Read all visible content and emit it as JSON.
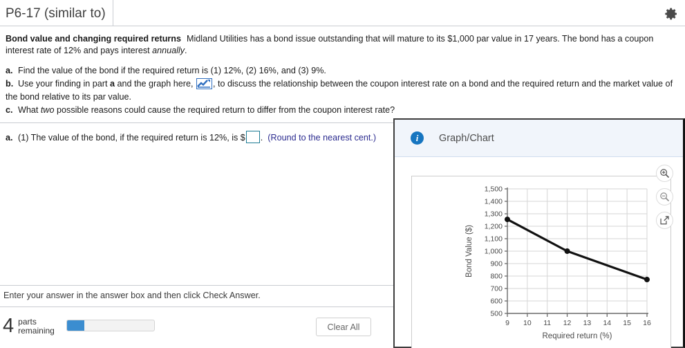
{
  "window": {
    "tab_title": "P6-17 (similar to)",
    "gear_icon": "gear-icon"
  },
  "question": {
    "bold_title": "Bond value and changing required returns",
    "stem": "Midland Utilities has a bond issue outstanding that will mature to its $1,000 par value in 17 years.  The bond has a coupon interest rate of 12% and pays interest ",
    "stem_italic": "annually",
    "stem_end": ".",
    "parts": [
      {
        "label": "a.",
        "text": "Find the value of the bond if the required return is (1) 12%, (2) 16%, and (3) 9%."
      },
      {
        "label": "b.",
        "text_pre": "Use your finding in part ",
        "text_bold": "a",
        "text_mid": " and the graph here, ",
        "icon": "line-chart-icon",
        "text_post": ", to discuss the relationship between the coupon interest rate on a bond and the required return and the market value of the bond relative to its par value."
      },
      {
        "label": "c.",
        "text_pre": "What ",
        "text_italic": "two",
        "text_post": " possible reasons could cause the required return to differ from the coupon interest rate?"
      }
    ]
  },
  "answer": {
    "label": "a.",
    "prompt": "(1) The value of the bond, if the required return is 12%, is $",
    "input_value": "",
    "input_placeholder": "",
    "suffix": ".",
    "hint": "(Round to the nearest cent.)"
  },
  "footer": {
    "instruction": "Enter your answer in the answer box and then click Check Answer.",
    "parts_count": "4",
    "parts_word_line1": "parts",
    "parts_word_line2": "remaining",
    "progress_percent": 20,
    "progress_color": "#3b8dd0",
    "clear_all_label": "Clear All"
  },
  "graph_panel": {
    "info_icon": "info-icon",
    "info_glyph": "i",
    "title": "Graph/Chart",
    "tools": [
      {
        "name": "zoom-in-icon",
        "label": "Zoom in"
      },
      {
        "name": "zoom-out-icon",
        "label": "Zoom out"
      },
      {
        "name": "expand-icon",
        "label": "Open in new window"
      }
    ]
  },
  "chart_data": {
    "type": "line",
    "title": "",
    "xlabel": "Required return (%)",
    "ylabel": "Bond Value ($)",
    "x": [
      9,
      12,
      16
    ],
    "values": [
      1255,
      1000,
      772
    ],
    "series": [
      {
        "name": "Bond value",
        "values": [
          1255,
          1000,
          772
        ]
      }
    ],
    "xlim": [
      9,
      16
    ],
    "ylim": [
      500,
      1500
    ],
    "xticks": [
      9,
      10,
      11,
      12,
      13,
      14,
      15,
      16
    ],
    "xtick_labels": [
      "9",
      "10",
      "11",
      "12",
      "13",
      "14",
      "15",
      "16"
    ],
    "yticks": [
      500,
      600,
      700,
      800,
      900,
      1000,
      1100,
      1200,
      1300,
      1400,
      1500
    ],
    "ytick_labels": [
      "500",
      "600",
      "700",
      "800",
      "900",
      "1,000",
      "1,100",
      "1,200",
      "1,300",
      "1,400",
      "1,500"
    ],
    "grid": true,
    "legend": "none",
    "line_color": "#111111",
    "marker": "circle",
    "marker_color": "#111111"
  }
}
